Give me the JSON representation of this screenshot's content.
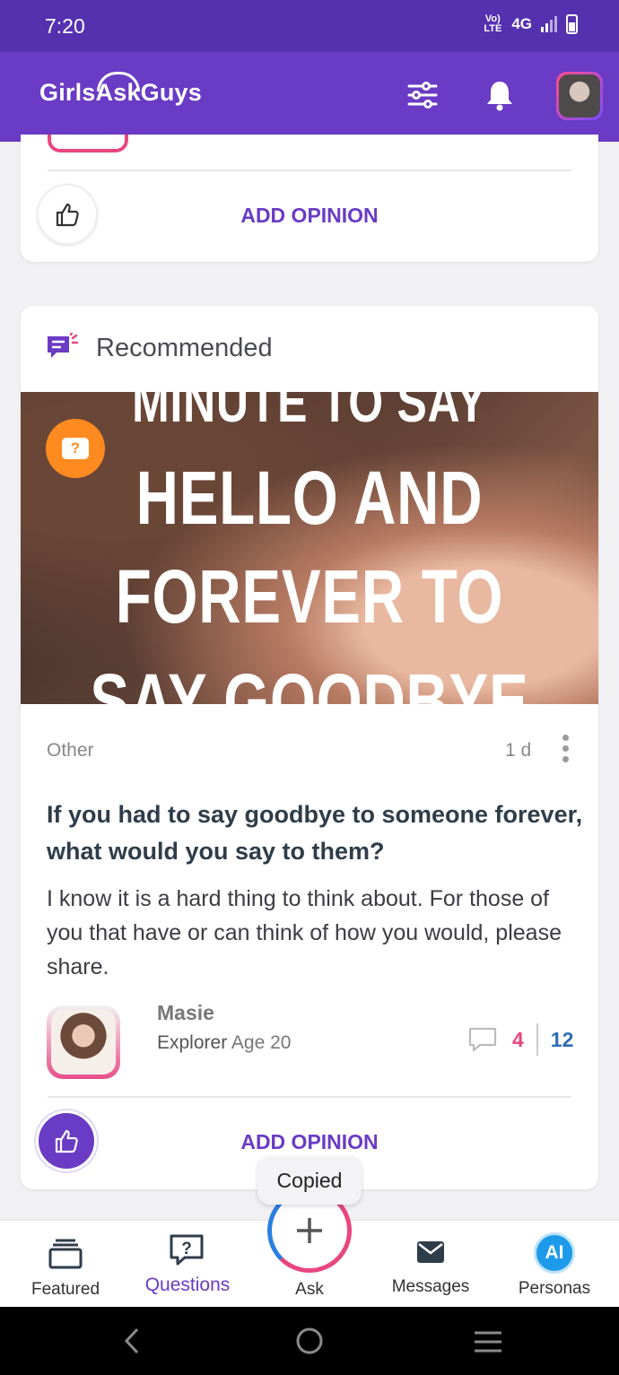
{
  "status_bar": {
    "time": "7:20",
    "network": "4G",
    "volte": "Vo) LTE"
  },
  "header": {
    "logo": "GirlsAskGuys",
    "icons": [
      "filter-icon",
      "bell-icon",
      "profile-avatar"
    ]
  },
  "card_previous": {
    "add_opinion": "ADD OPINION"
  },
  "recommended": {
    "heading": "Recommended",
    "image_text": [
      "MINUTE TO SAY",
      "HELLO AND",
      "FOREVER TO",
      "SAY GOODBYE"
    ],
    "category": "Other",
    "time_ago": "1 d",
    "title": "If you had to say goodbye to someone forever, what would you say to them?",
    "body": "I know it is a hard thing to think about. For those of you that have or can think of how you would, please share.",
    "author": {
      "name": "Masie",
      "role": "Explorer",
      "age": "Age 20"
    },
    "comments_count": "4",
    "views_count": "12",
    "add_opinion": "ADD OPINION"
  },
  "toast": "Copied",
  "bottom_nav": {
    "featured": "Featured",
    "questions": "Questions",
    "ask": "Ask",
    "messages": "Messages",
    "personas": "Personas"
  },
  "colors": {
    "brand_purple": "#6a3bc4",
    "status_purple": "#5531b0",
    "accent_pink": "#e8467f",
    "accent_blue": "#2f6db0",
    "badge_orange": "#ff8a1f"
  }
}
